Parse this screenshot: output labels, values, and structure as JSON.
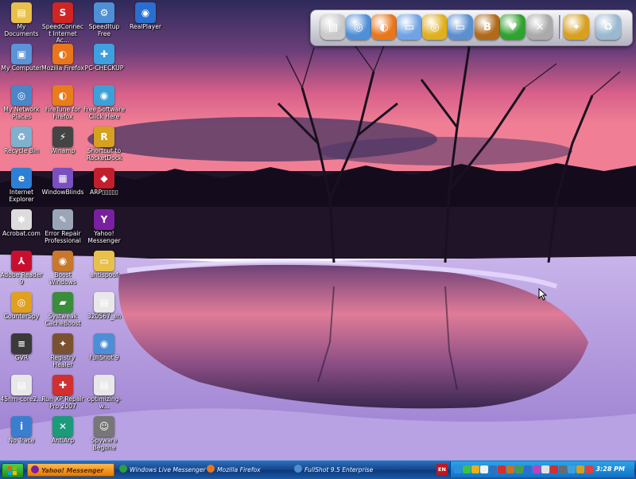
{
  "desktop_icons": [
    {
      "label": "My Documents",
      "icon": "folder-documents-icon",
      "color": "#e8c04a",
      "glyph": "▤"
    },
    {
      "label": "SpeedConnect Internet Ac...",
      "icon": "speedconnect-icon",
      "color": "#d02525",
      "glyph": "S"
    },
    {
      "label": "SpeedItup Free",
      "icon": "speeditup-icon",
      "color": "#4f8fd6",
      "glyph": "⚙"
    },
    {
      "label": "RealPlayer",
      "icon": "realplayer-icon",
      "color": "#2a6fcf",
      "glyph": "◉"
    },
    {
      "label": "My Computer",
      "icon": "computer-icon",
      "color": "#5a93d8",
      "glyph": "▣"
    },
    {
      "label": "Mozilla Firefox",
      "icon": "firefox-icon",
      "color": "#e8771c",
      "glyph": "◐"
    },
    {
      "label": "PC-CHECKUP",
      "icon": "pc-checkup-icon",
      "color": "#3fa0e0",
      "glyph": "✚"
    },
    {
      "label": "My Network Places",
      "icon": "network-icon",
      "color": "#4a86c8",
      "glyph": "◎"
    },
    {
      "label": "FireTune for Firefox",
      "icon": "firetune-icon",
      "color": "#e87d1c",
      "glyph": "◐"
    },
    {
      "label": "Free Software Click Here",
      "icon": "free-software-icon",
      "color": "#3ea0d8",
      "glyph": "◉"
    },
    {
      "label": "Recycle Bin",
      "icon": "recycle-bin-icon",
      "color": "#7fb0d0",
      "glyph": "♻"
    },
    {
      "label": "Winamp",
      "icon": "winamp-icon",
      "color": "#444444",
      "glyph": "⚡"
    },
    {
      "label": "Shortcut to RocketDock",
      "icon": "rocketdock-icon",
      "color": "#d6a020",
      "glyph": "R"
    },
    {
      "label": "Internet Explorer",
      "icon": "internet-explorer-icon",
      "color": "#2d7fd6",
      "glyph": "e"
    },
    {
      "label": "WindowBlinds",
      "icon": "windowblinds-icon",
      "color": "#7a4fc0",
      "glyph": "▦"
    },
    {
      "label": "ARP▯▯▯▯▯",
      "icon": "arp-shield-icon",
      "color": "#c21f2e",
      "glyph": "◆"
    },
    {
      "label": "Acrobat.com",
      "icon": "acrobat-icon",
      "color": "#dcdcdc",
      "glyph": "✱"
    },
    {
      "label": "Error Repair Professional",
      "icon": "error-repair-icon",
      "color": "#9aa6b8",
      "glyph": "✎"
    },
    {
      "label": "Yahoo! Messenger",
      "icon": "yahoo-messenger-icon",
      "color": "#7b1fa2",
      "glyph": "Y"
    },
    {
      "label": "Adobe Reader 9",
      "icon": "adobe-reader-icon",
      "color": "#c8102e",
      "glyph": "⅄"
    },
    {
      "label": "Boost Windows",
      "icon": "boost-windows-icon",
      "color": "#c7782a",
      "glyph": "◉"
    },
    {
      "label": "antispoof",
      "icon": "folder-icon",
      "color": "#e8c04a",
      "glyph": "▭"
    },
    {
      "label": "CounterSpy",
      "icon": "counterspy-icon",
      "color": "#e0a020",
      "glyph": "◎"
    },
    {
      "label": "Systweak CacheBoost",
      "icon": "cacheboost-icon",
      "color": "#3a8d3a",
      "glyph": "▰"
    },
    {
      "label": "320567_en",
      "icon": "pdf-icon",
      "color": "#e8e8e8",
      "glyph": "▤"
    },
    {
      "label": "GVR",
      "icon": "gvr-icon",
      "color": "#3a3a3a",
      "glyph": "≡"
    },
    {
      "label": "Registry Healer",
      "icon": "registry-healer-icon",
      "color": "#7a5230",
      "glyph": "✦"
    },
    {
      "label": "FullShot 9",
      "icon": "fullshot-icon",
      "color": "#4d8fd6",
      "glyph": "◉"
    },
    {
      "label": "45nm-core2...",
      "icon": "pdf-icon",
      "color": "#e8e8e8",
      "glyph": "▤"
    },
    {
      "label": "Run XP Repair Pro 2007",
      "icon": "xp-repair-icon",
      "color": "#d03030",
      "glyph": "✚"
    },
    {
      "label": "optimizing-w...",
      "icon": "pdf-icon",
      "color": "#e8e8e8",
      "glyph": "▤"
    },
    {
      "label": "No Trace",
      "icon": "no-trace-icon",
      "color": "#3a7fcf",
      "glyph": "i"
    },
    {
      "label": "AntiArp",
      "icon": "antiarp-icon",
      "color": "#1a9c7a",
      "glyph": "✕"
    },
    {
      "label": "Spyware Begone",
      "icon": "spyware-begone-icon",
      "color": "#777777",
      "glyph": "☺"
    }
  ],
  "dock_items": [
    {
      "icon": "documents-dock-icon",
      "color": "#c9c9c9",
      "glyph": "▤"
    },
    {
      "icon": "network-globe-dock-icon",
      "color": "#4f8fd6",
      "glyph": "◎"
    },
    {
      "icon": "firefox-dock-icon",
      "color": "#e8771c",
      "glyph": "◐"
    },
    {
      "icon": "folder-dock-icon",
      "color": "#6fa3e6",
      "glyph": "▭"
    },
    {
      "icon": "counterspy-dock-icon",
      "color": "#e0b020",
      "glyph": "◎"
    },
    {
      "icon": "folder-open-dock-icon",
      "color": "#5b8fd0",
      "glyph": "▭"
    },
    {
      "icon": "windowblinds-dock-icon",
      "color": "#b06a1a",
      "glyph": "B"
    },
    {
      "icon": "heart-dock-icon",
      "color": "#2fa22f",
      "glyph": "♥"
    },
    {
      "icon": "tools-dock-icon",
      "color": "#aaaaaa",
      "glyph": "✕"
    },
    {
      "icon": "hammer-dock-icon",
      "color": "#d8a020",
      "glyph": "✦"
    },
    {
      "icon": "recycle-bin-dock-icon",
      "color": "#9ab8d0",
      "glyph": "♻"
    }
  ],
  "taskbar": {
    "tasks": [
      {
        "label": "Yahoo! Messenger",
        "icon": "yahoo-task-icon",
        "active": true
      },
      {
        "label": "Windows Live Messenger",
        "icon": "wlm-task-icon",
        "active": false
      },
      {
        "label": "Mozilla Firefox",
        "icon": "firefox-task-icon",
        "active": false
      },
      {
        "label": "FullShot 9.5 Enterprise",
        "icon": "fullshot-task-icon",
        "active": false
      }
    ],
    "lang": "EN",
    "clock": "3:28 PM"
  },
  "colors": {
    "taskbar": "#14478e",
    "tray": "#1f8ad8",
    "active_task": "#f29a20"
  }
}
